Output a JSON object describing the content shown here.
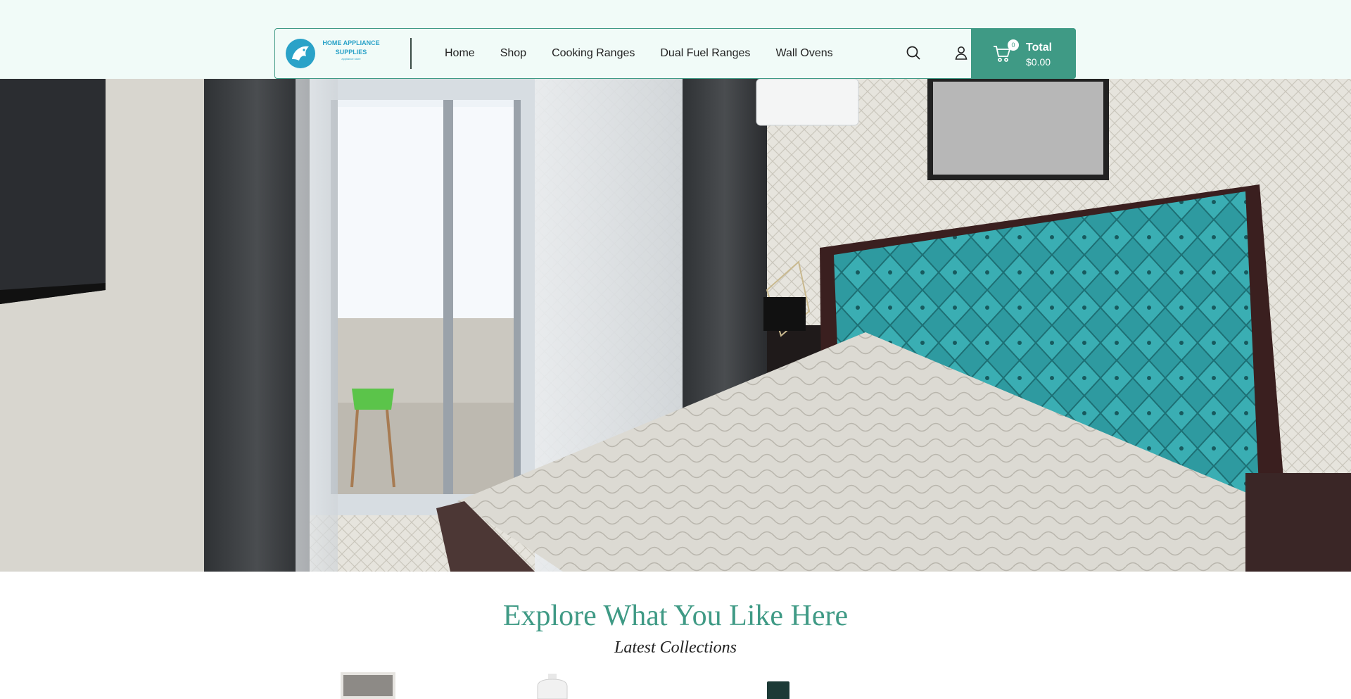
{
  "brand": {
    "title": "HOME APPLIANCE SUPPLIES",
    "tagline": "appliance store",
    "colors": {
      "accent": "#3f9a85",
      "logo_blue": "#2aa2c8",
      "header_bg": "#f1fbf8"
    }
  },
  "nav": {
    "items": [
      {
        "label": "Home"
      },
      {
        "label": "Shop"
      },
      {
        "label": "Cooking Ranges"
      },
      {
        "label": "Dual Fuel Ranges"
      },
      {
        "label": "Wall Ovens"
      }
    ]
  },
  "header_icons": [
    "search-icon",
    "user-icon",
    "cart-icon"
  ],
  "cart": {
    "count": "0",
    "label": "Total",
    "value": "$0.00"
  },
  "hero": {
    "image": "bedroom-scene"
  },
  "collections": {
    "title": "Explore What You Like Here",
    "subtitle": "Latest Collections"
  }
}
